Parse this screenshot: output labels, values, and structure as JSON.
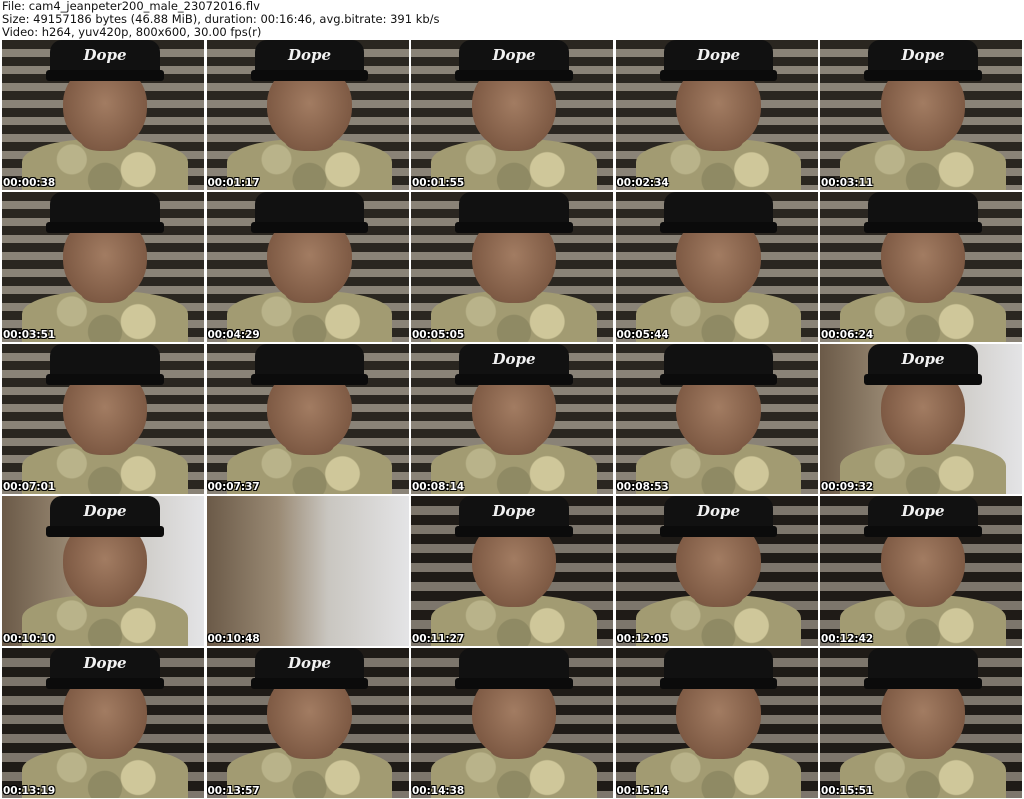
{
  "header": {
    "line1": "File: cam4_jeanpeter200_male_23072016.flv",
    "line2": "Size: 49157186 bytes (46.88 MiB), duration: 00:16:46, avg.bitrate: 391 kb/s",
    "line3": "Video: h264, yuv420p, 800x600, 30.00 fps(r)"
  },
  "cap_text": "Dope",
  "thumbnails": [
    {
      "time": "00:00:38"
    },
    {
      "time": "00:01:17"
    },
    {
      "time": "00:01:55"
    },
    {
      "time": "00:02:34"
    },
    {
      "time": "00:03:11"
    },
    {
      "time": "00:03:51"
    },
    {
      "time": "00:04:29"
    },
    {
      "time": "00:05:05"
    },
    {
      "time": "00:05:44"
    },
    {
      "time": "00:06:24"
    },
    {
      "time": "00:07:01"
    },
    {
      "time": "00:07:37"
    },
    {
      "time": "00:08:14"
    },
    {
      "time": "00:08:53"
    },
    {
      "time": "00:09:32"
    },
    {
      "time": "00:10:10"
    },
    {
      "time": "00:10:48"
    },
    {
      "time": "00:11:27"
    },
    {
      "time": "00:12:05"
    },
    {
      "time": "00:12:42"
    },
    {
      "time": "00:13:19"
    },
    {
      "time": "00:13:57"
    },
    {
      "time": "00:14:38"
    },
    {
      "time": "00:15:14"
    },
    {
      "time": "00:15:51"
    }
  ]
}
